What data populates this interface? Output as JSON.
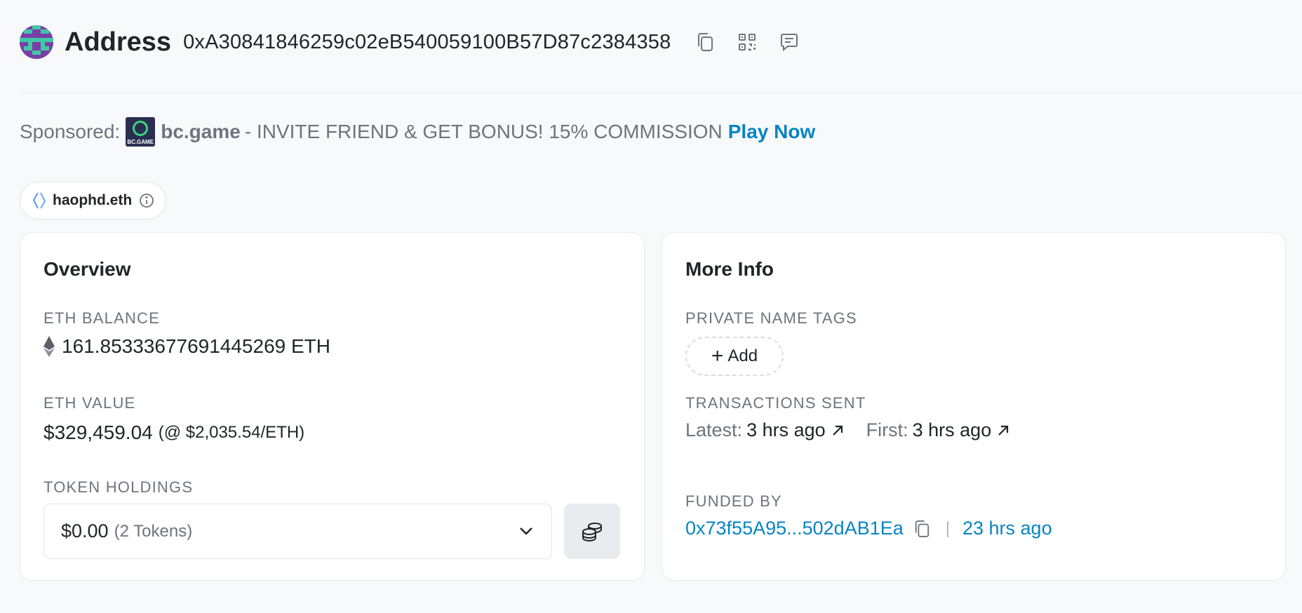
{
  "header": {
    "title": "Address",
    "address": "0xA30841846259c02eB540059100B57D87c2384358"
  },
  "sponsored": {
    "label": "Sponsored:",
    "logo_text": "BC.GAME",
    "brand": "bc.game",
    "message": "- INVITE FRIEND & GET BONUS! 15% COMMISSION",
    "cta": "Play Now"
  },
  "ens": {
    "name": "haophd.eth"
  },
  "overview": {
    "title": "Overview",
    "eth_balance_label": "ETH BALANCE",
    "eth_balance_value": "161.85333677691445269 ETH",
    "eth_value_label": "ETH VALUE",
    "eth_value": "$329,459.04",
    "eth_price": "(@ $2,035.54/ETH)",
    "token_holdings_label": "TOKEN HOLDINGS",
    "token_amount": "$0.00",
    "token_count": "(2 Tokens)"
  },
  "more_info": {
    "title": "More Info",
    "private_tags_label": "PRIVATE NAME TAGS",
    "add_label": "Add",
    "tx_sent_label": "TRANSACTIONS SENT",
    "latest_key": "Latest:",
    "latest_value": "3 hrs ago",
    "first_key": "First:",
    "first_value": "3 hrs ago",
    "funded_by_label": "FUNDED BY",
    "funded_by_address": "0x73f55A95...502dAB1Ea",
    "funded_by_separator": "|",
    "funded_by_time": "23 hrs ago"
  },
  "colors": {
    "link": "#0784c3",
    "muted": "#6c757d",
    "background": "#f8f9fb"
  }
}
